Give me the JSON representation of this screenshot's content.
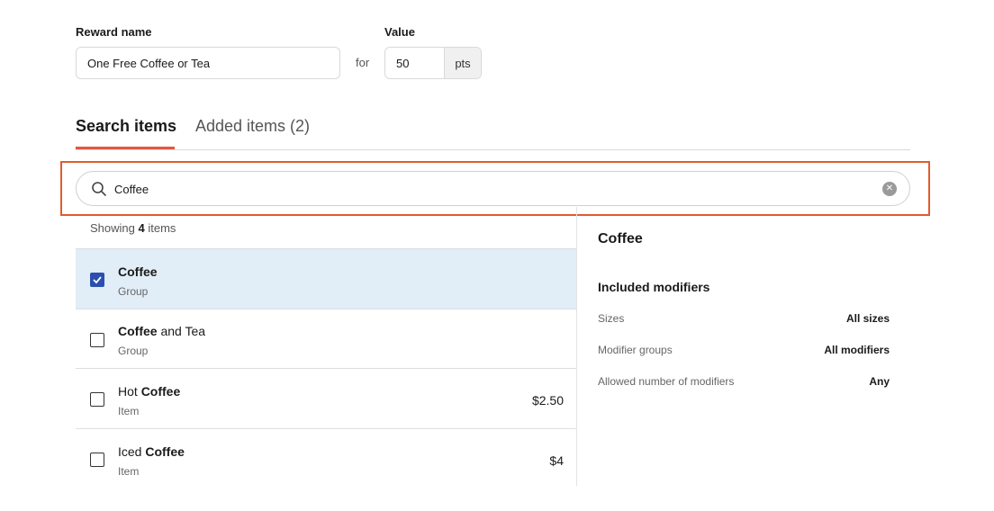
{
  "form": {
    "reward_name_label": "Reward name",
    "reward_name_value": "One Free Coffee or Tea",
    "value_label": "Value",
    "for_text": "for",
    "value_value": "50",
    "value_unit": "pts"
  },
  "tabs": [
    {
      "label": "Search items",
      "active": true
    },
    {
      "label": "Added items (2)",
      "active": false
    }
  ],
  "search": {
    "value": "Coffee",
    "icon": "search-icon",
    "clear_icon": "clear-icon"
  },
  "results": {
    "showing_prefix": "Showing",
    "showing_count": "4",
    "showing_suffix": "items",
    "items": [
      {
        "title_pre": "",
        "title_bold": "Coffee",
        "title_post": "",
        "type": "Group",
        "price": "",
        "checked": true
      },
      {
        "title_pre": "",
        "title_bold": "Coffee",
        "title_post": " and Tea",
        "type": "Group",
        "price": "",
        "checked": false
      },
      {
        "title_pre": "Hot ",
        "title_bold": "Coffee",
        "title_post": "",
        "type": "Item",
        "price": "$2.50",
        "checked": false
      },
      {
        "title_pre": "Iced ",
        "title_bold": "Coffee",
        "title_post": "",
        "type": "Item",
        "price": "$4",
        "checked": false
      }
    ]
  },
  "detail": {
    "title": "Coffee",
    "included_heading": "Included modifiers",
    "rows": [
      {
        "label": "Sizes",
        "value": "All sizes"
      },
      {
        "label": "Modifier groups",
        "value": "All modifiers"
      },
      {
        "label": "Allowed number of modifiers",
        "value": "Any"
      }
    ]
  },
  "colors": {
    "accent": "#e8553d",
    "highlight_border": "#e25b2c",
    "selected_row_bg": "#e1edf7",
    "checkbox_checked": "#2b4fae"
  }
}
